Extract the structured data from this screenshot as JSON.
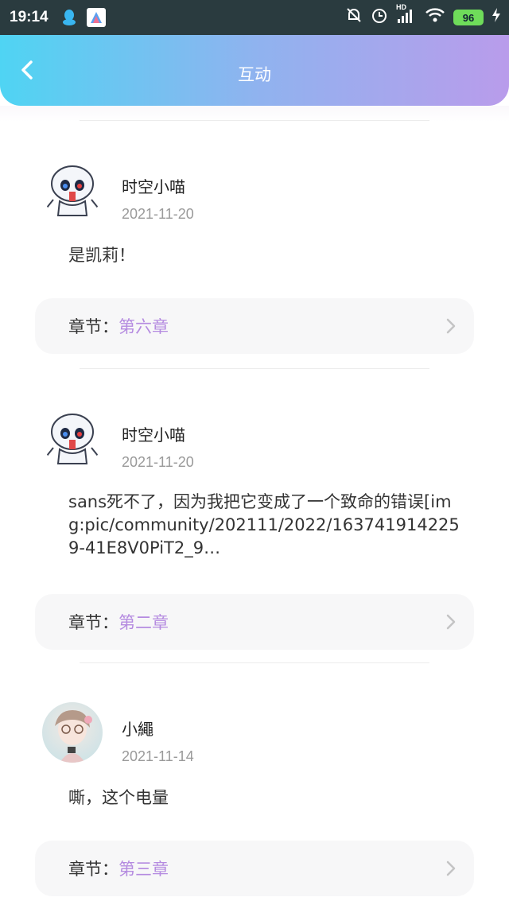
{
  "status_bar": {
    "time": "19:14",
    "battery": "96",
    "signal_label": "HD"
  },
  "header": {
    "title": "互动"
  },
  "colors": {
    "accent_purple": "#b58be0",
    "header_start": "#4fd4f3",
    "header_end": "#b99ceb"
  },
  "comments": [
    {
      "user": "时空小喵",
      "date": "2021-11-20",
      "text": "是凯莉！",
      "chapter_label": "章节：",
      "chapter": "第六章"
    },
    {
      "user": "时空小喵",
      "date": "2021-11-20",
      "text": "sans死不了，因为我把它变成了一个致命的错误[img:pic/community/202111/2022/1637419142259-41E8V0PiT2_9…",
      "chapter_label": "章节：",
      "chapter": "第二章"
    },
    {
      "user": "小繩",
      "date": "2021-11-14",
      "text": "嘶，这个电量",
      "chapter_label": "章节：",
      "chapter": "第三章"
    }
  ]
}
